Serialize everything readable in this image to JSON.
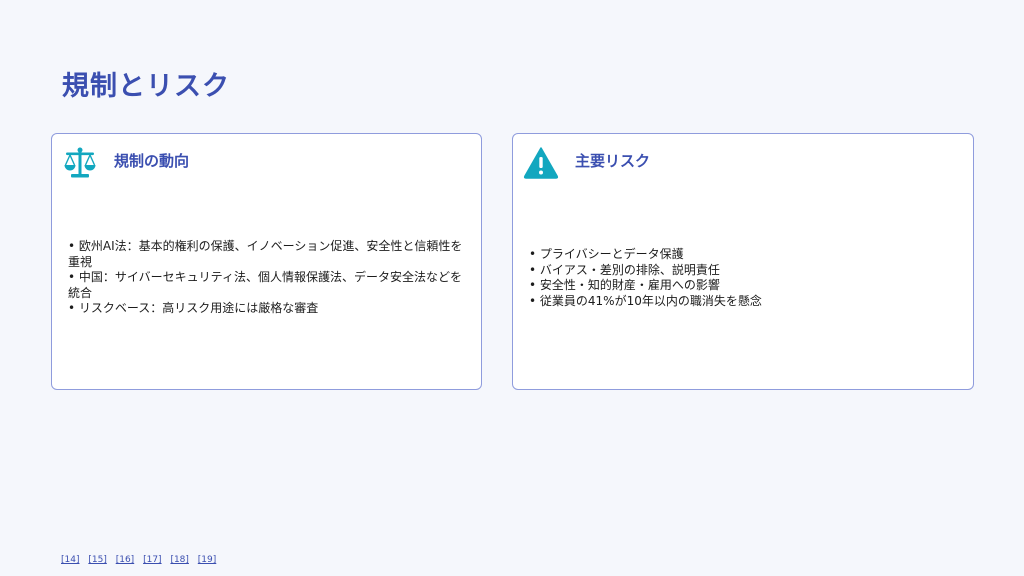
{
  "slide": {
    "title": "規制とリスク"
  },
  "cards": {
    "regulation": {
      "icon": "scales-icon",
      "title": "規制の動向",
      "bullets": [
        "欧州AI法：基本的権利の保護、イノベーション促進、安全性と信頼性を重視",
        "中国：サイバーセキュリティ法、個人情報保護法、データ安全法などを統合",
        "リスクベース：高リスク用途には厳格な審査"
      ]
    },
    "risks": {
      "icon": "warning-icon",
      "title": "主要リスク",
      "bullets": [
        "プライバシーとデータ保護",
        "バイアス・差別の排除、説明責任",
        "安全性・知的財産・雇用への影響",
        "従業員の41%が10年以内の職消失を懸念"
      ]
    }
  },
  "references": [
    "[14]",
    "[15]",
    "[16]",
    "[17]",
    "[18]",
    "[19]"
  ],
  "colors": {
    "accent": "#3b4fb0",
    "icon": "#12a7bf",
    "border": "#8f9cdd",
    "background": "#f5f7fc"
  }
}
